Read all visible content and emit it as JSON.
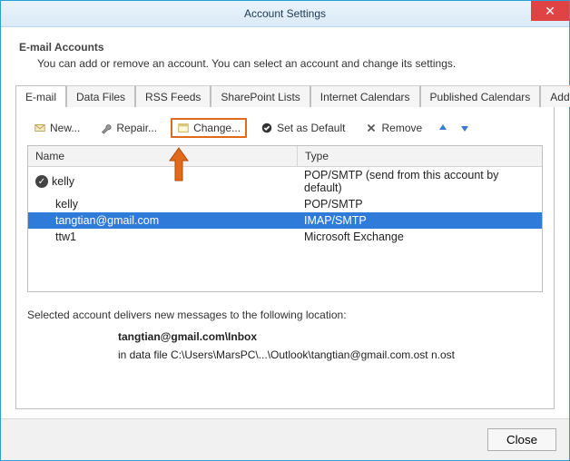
{
  "window": {
    "title": "Account Settings"
  },
  "header": {
    "title": "E-mail Accounts",
    "desc": "You can add or remove an account. You can select an account and change its settings."
  },
  "tabs": [
    {
      "label": "E-mail"
    },
    {
      "label": "Data Files"
    },
    {
      "label": "RSS Feeds"
    },
    {
      "label": "SharePoint Lists"
    },
    {
      "label": "Internet Calendars"
    },
    {
      "label": "Published Calendars"
    },
    {
      "label": "Address Books"
    }
  ],
  "toolbar": {
    "new_label": "New...",
    "repair_label": "Repair...",
    "change_label": "Change...",
    "default_label": "Set as Default",
    "remove_label": "Remove"
  },
  "columns": {
    "name": "Name",
    "type": "Type"
  },
  "accounts": [
    {
      "name": "kelly",
      "type": "POP/SMTP (send from this account by default)",
      "default": true,
      "selected": false
    },
    {
      "name": "kelly",
      "type": "POP/SMTP",
      "default": false,
      "selected": false
    },
    {
      "name": "tangtian@gmail.com",
      "type": "IMAP/SMTP",
      "default": false,
      "selected": true
    },
    {
      "name": "ttw1",
      "type": "Microsoft Exchange",
      "default": false,
      "selected": false
    }
  ],
  "delivery": {
    "intro": "Selected account delivers new messages to the following location:",
    "target": "tangtian@gmail.com\\Inbox",
    "path": "in data file C:\\Users\\MarsPC\\...\\Outlook\\tangtian@gmail.com.ost   n.ost"
  },
  "buttons": {
    "close": "Close"
  }
}
